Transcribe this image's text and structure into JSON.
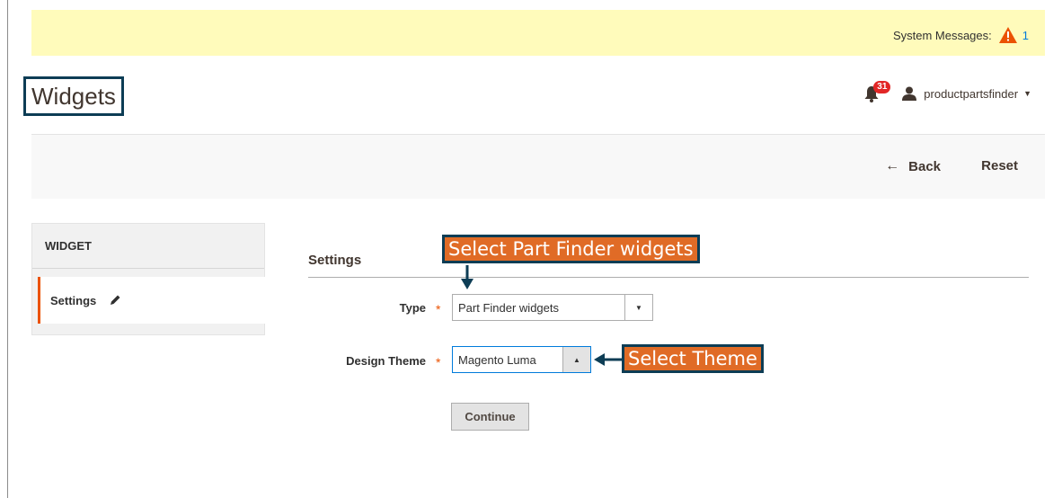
{
  "system_messages": {
    "label": "System Messages:",
    "count": "1",
    "icon": "warning-triangle-icon"
  },
  "page": {
    "title": "Widgets"
  },
  "header": {
    "notifications_count": "31",
    "username": "productpartsfinder"
  },
  "action_bar": {
    "back_label": "Back",
    "reset_label": "Reset"
  },
  "sidebar": {
    "title": "WIDGET",
    "items": [
      {
        "label": "Settings",
        "active": true
      }
    ]
  },
  "settings": {
    "title": "Settings",
    "type": {
      "label": "Type",
      "required_mark": "*",
      "value": "Part Finder widgets"
    },
    "design_theme": {
      "label": "Design Theme",
      "required_mark": "*",
      "value": "Magento Luma"
    },
    "continue_label": "Continue"
  },
  "annotations": {
    "type_callout": "Select Part Finder widgets",
    "theme_callout": "Select Theme"
  },
  "colors": {
    "accent": "#eb5202",
    "system_bar": "#fffbbb",
    "callout_bg": "#e06b26",
    "callout_border": "#0d3d55",
    "link": "#007bdb",
    "badge": "#e22626"
  }
}
